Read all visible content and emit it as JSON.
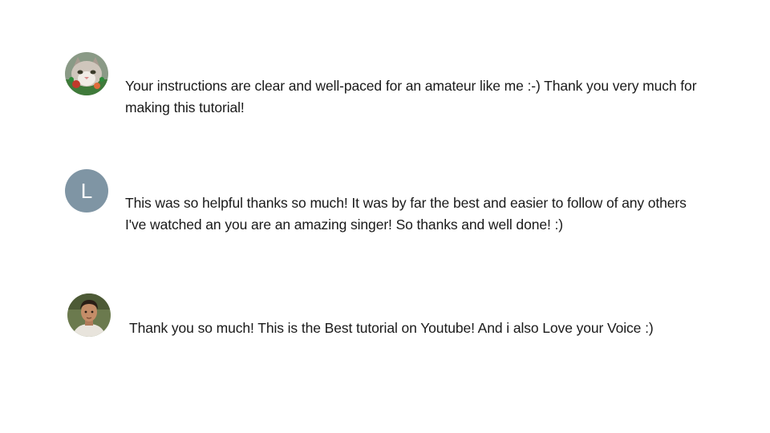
{
  "comments": [
    {
      "avatar": {
        "type": "image",
        "icon": "cat-avatar-icon"
      },
      "text": "Your instructions are clear and well-paced for an amateur like me :-) Thank you very much for making this tutorial!"
    },
    {
      "avatar": {
        "type": "letter",
        "letter": "L",
        "color": "#7f95a4"
      },
      "text": "This was so helpful thanks so much! It was by far the best and easier to follow of any others I've watched an you are an amazing singer! So thanks and well done! :)"
    },
    {
      "avatar": {
        "type": "image",
        "icon": "person-avatar-icon"
      },
      "text": "Thank you so much! This is the Best tutorial on Youtube! And i also Love your Voice :)"
    }
  ]
}
